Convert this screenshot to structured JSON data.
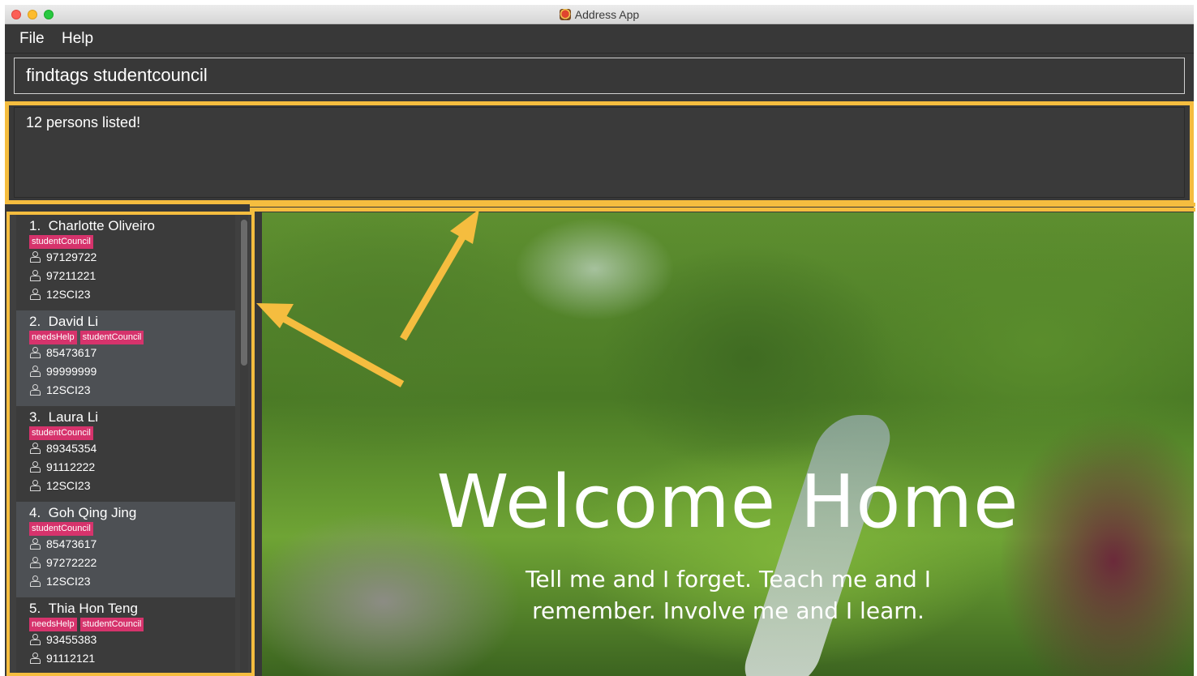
{
  "window": {
    "title": "Address App"
  },
  "menu": {
    "file": "File",
    "help": "Help"
  },
  "command_box": {
    "value": "findtags studentcouncil"
  },
  "result_display": {
    "text": "12 persons listed!"
  },
  "persons": [
    {
      "index": "1.",
      "name": "Charlotte Oliveiro",
      "tags": [
        "studentCouncil"
      ],
      "phone1": "97129722",
      "phone2": "97211221",
      "class": "12SCI23"
    },
    {
      "index": "2.",
      "name": "David Li",
      "tags": [
        "needsHelp",
        "studentCouncil"
      ],
      "phone1": "85473617",
      "phone2": "99999999",
      "class": "12SCI23"
    },
    {
      "index": "3.",
      "name": "Laura Li",
      "tags": [
        "studentCouncil"
      ],
      "phone1": "89345354",
      "phone2": "91112222",
      "class": "12SCI23"
    },
    {
      "index": "4.",
      "name": "Goh Qing Jing",
      "tags": [
        "studentCouncil"
      ],
      "phone1": "85473617",
      "phone2": "97272222",
      "class": "12SCI23"
    },
    {
      "index": "5.",
      "name": "Thia Hon Teng",
      "tags": [
        "needsHelp",
        "studentCouncil"
      ],
      "phone1": "93455383",
      "phone2": "91112121",
      "class": ""
    }
  ],
  "browser": {
    "heading": "Welcome Home",
    "quote_line1": "Tell me and I forget. Teach me and I",
    "quote_line2": "remember. Involve me and I learn."
  },
  "colors": {
    "highlight": "#f5bd3f",
    "tag": "#d6336c",
    "panel": "#383838"
  },
  "icons": [
    "close-window-icon",
    "minimize-window-icon",
    "maximize-window-icon",
    "app-icon",
    "phone-icon",
    "parent-phone-icon",
    "class-icon"
  ]
}
